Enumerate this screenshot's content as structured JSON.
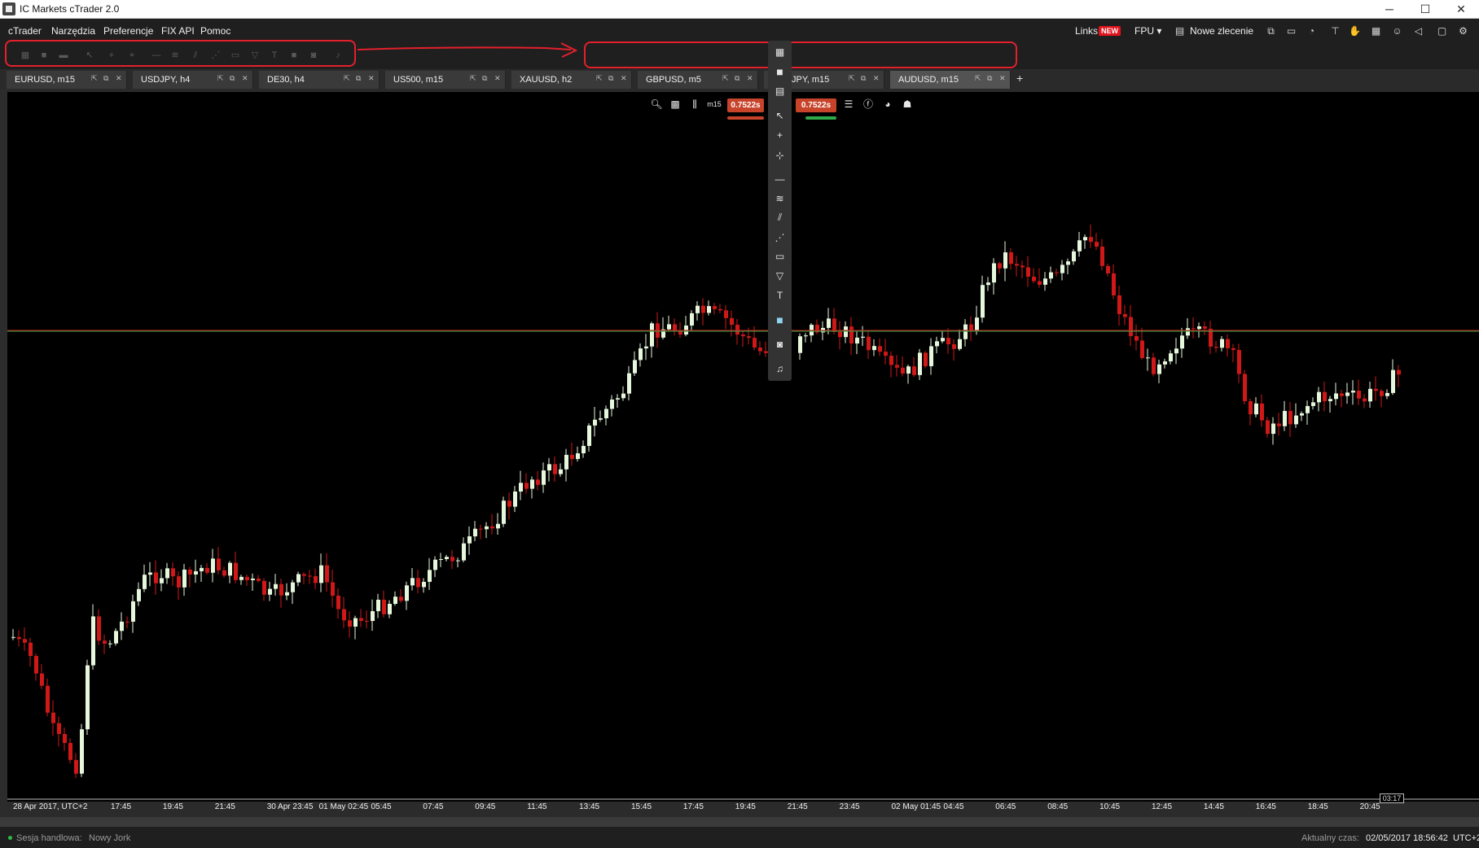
{
  "window": {
    "title": "IC Markets cTrader 2.0"
  },
  "menu": {
    "items": [
      "cTrader",
      "Narzędzia",
      "Preferencje",
      "FIX API",
      "Pomoc"
    ],
    "links_label": "Links",
    "links_badge": "NEW",
    "account_label": "FPU ▾",
    "new_order_label": "Nowe zlecenie"
  },
  "tabs": [
    {
      "label": "EURUSD, m15"
    },
    {
      "label": "USDJPY, h4"
    },
    {
      "label": "DE30, h4"
    },
    {
      "label": "US500, m15"
    },
    {
      "label": "XAUUSD, h2"
    },
    {
      "label": "GBPUSD, m5"
    },
    {
      "label": "JPY, m15"
    },
    {
      "label": "AUDUSD, m15"
    }
  ],
  "chart_tools": {
    "bid_price": "0.7522s",
    "ask_price": "0.7522s",
    "timeframe_icon": "m15"
  },
  "chart_data": {
    "type": "candlestick",
    "symbol": "AUDUSD",
    "timeframe": "m15",
    "x_labels": [
      "28 Apr 2017, UTC+2",
      "17:45",
      "19:45",
      "21:45",
      "30 Apr 23:45",
      "01 May 02:45",
      "05:45",
      "07:45",
      "09:45",
      "11:45",
      "13:45",
      "15:45",
      "17:45",
      "19:45",
      "21:45",
      "23:45",
      "02 May 01:45",
      "04:45",
      "06:45",
      "08:45",
      "10:45",
      "12:45",
      "14:45",
      "16:45",
      "18:45",
      "20:45"
    ],
    "current_time_label": "03:17",
    "bull_color": "#e6f7dc",
    "bear_color": "#d01818",
    "grid": false
  },
  "status": {
    "session_label": "Sesja handlowa:",
    "session_value": "Nowy Jork",
    "time_label": "Aktualny czas:",
    "time_value": "02/05/2017 18:56:42",
    "timezone": "UTC+2"
  }
}
